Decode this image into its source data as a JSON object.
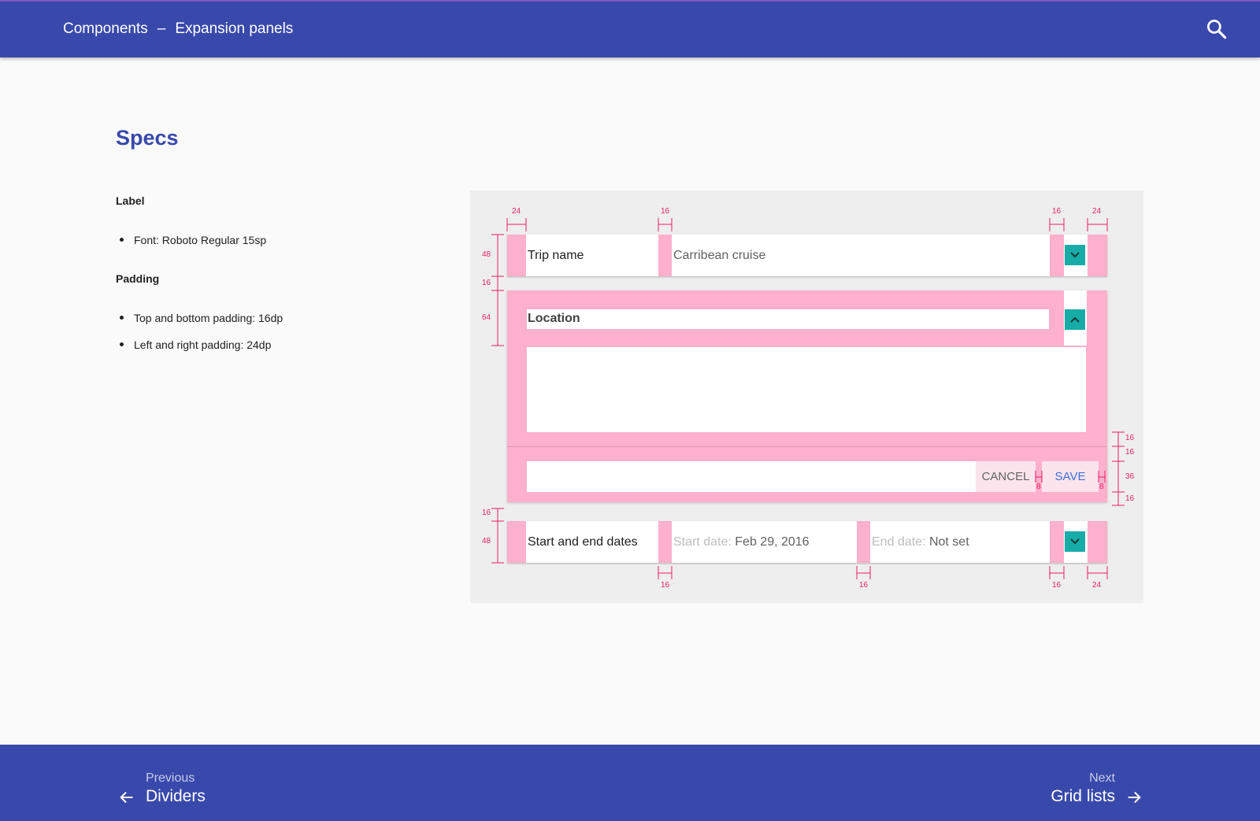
{
  "header": {
    "section": "Components",
    "separator": "–",
    "page": "Expansion panels",
    "search_icon": "search-icon"
  },
  "main": {
    "title": "Specs",
    "label_heading": "Label",
    "label_items": [
      "Font: Roboto Regular 15sp"
    ],
    "padding_heading": "Padding",
    "padding_items": [
      "Top and bottom padding: 16dp",
      "Left and right padding: 24dp"
    ]
  },
  "diagram": {
    "panel1": {
      "title": "Trip name",
      "value": "Carribean cruise"
    },
    "panel2": {
      "title": "Location",
      "cancel": "CANCEL",
      "save": "SAVE"
    },
    "panel3": {
      "title": "Start and end dates",
      "start_label": "Start date:",
      "start_value": "Feb 29, 2016",
      "end_label": "End date:",
      "end_value": "Not set"
    },
    "measures": {
      "top_24_left": "24",
      "top_16_a": "16",
      "top_16_b": "16",
      "top_24_right": "24",
      "left_48_a": "48",
      "left_16_a": "16",
      "left_64": "64",
      "left_16_b": "16",
      "left_48_b": "48",
      "right_16_a": "16",
      "right_16_b": "16",
      "right_36": "36",
      "right_16_c": "16",
      "btn_8_a": "8",
      "btn_8_b": "8",
      "bottom_16_a": "16",
      "bottom_16_b": "16",
      "bottom_16_c": "16",
      "bottom_24": "24"
    },
    "colors": {
      "spacing": "#ffb0cc",
      "icon": "#17aca8",
      "measure": "#e91e63"
    }
  },
  "footer": {
    "prev_label": "Previous",
    "prev_title": "Dividers",
    "next_label": "Next",
    "next_title": "Grid lists"
  }
}
